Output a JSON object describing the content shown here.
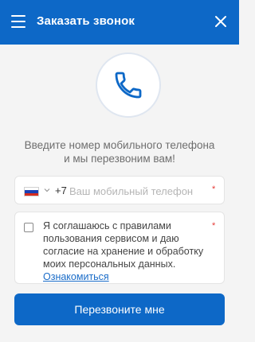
{
  "header": {
    "title": "Заказать звонок",
    "background": "#0d68c7"
  },
  "prompt": {
    "line1": "Введите номер мобильного телефона",
    "line2": "и мы перезвоним вам!"
  },
  "phone_field": {
    "country_code": "+7",
    "placeholder": "Ваш мобильный телефон",
    "value": "",
    "required_mark": "*",
    "country_flag": "russia-flag-icon"
  },
  "consent": {
    "text": "Я соглашаюсь с правилами пользования сервисом и даю согласие на хранение и обработку моих персональных данных.",
    "link_label": "Ознакомиться",
    "required_mark": "*",
    "checked": false
  },
  "submit": {
    "label": "Перезвоните мне"
  },
  "colors": {
    "accent": "#0d68c7",
    "link": "#1a6cc8",
    "required": "#e53935"
  }
}
